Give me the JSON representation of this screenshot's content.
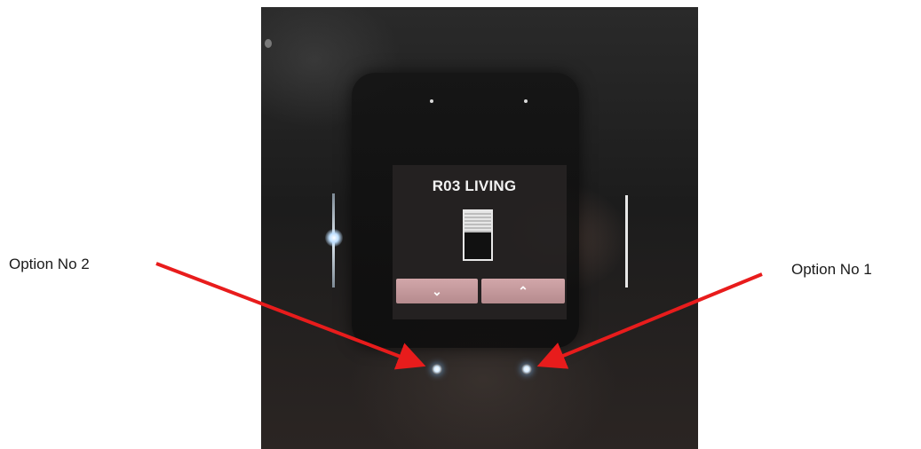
{
  "display": {
    "room_title": "R03 LIVING",
    "down_button_glyph": "⌄",
    "up_button_glyph": "⌃",
    "icon": "roller-blind-icon"
  },
  "annotations": {
    "option_2_label": "Option No 2",
    "option_1_label": "Option No 1"
  },
  "colors": {
    "arrow": "#e81c1c",
    "button": "#c59a9d",
    "led": "#cfe9ff"
  }
}
